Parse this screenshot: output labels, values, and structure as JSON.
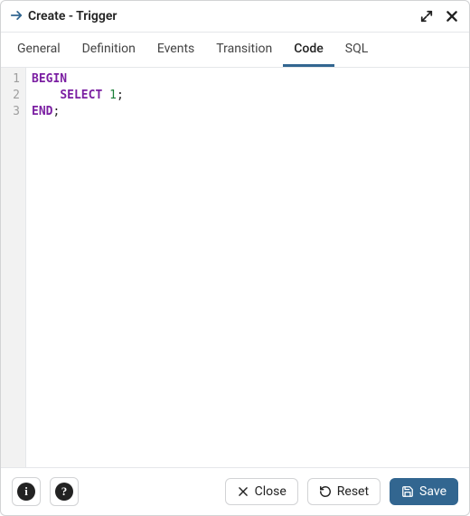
{
  "header": {
    "title": "Create - Trigger"
  },
  "tabs": [
    {
      "label": "General",
      "active": false
    },
    {
      "label": "Definition",
      "active": false
    },
    {
      "label": "Events",
      "active": false
    },
    {
      "label": "Transition",
      "active": false
    },
    {
      "label": "Code",
      "active": true
    },
    {
      "label": "SQL",
      "active": false
    }
  ],
  "code": {
    "lines": [
      {
        "n": "1",
        "tokens": [
          {
            "t": "BEGIN",
            "k": "keyword"
          }
        ]
      },
      {
        "n": "2",
        "tokens": [
          {
            "t": "    "
          },
          {
            "t": "SELECT",
            "k": "keyword"
          },
          {
            "t": " "
          },
          {
            "t": "1",
            "k": "number"
          },
          {
            "t": ";",
            "k": "punct"
          }
        ]
      },
      {
        "n": "3",
        "tokens": [
          {
            "t": "END",
            "k": "keyword"
          },
          {
            "t": ";",
            "k": "punct"
          }
        ]
      }
    ]
  },
  "footer": {
    "close_label": "Close",
    "reset_label": "Reset",
    "save_label": "Save"
  }
}
